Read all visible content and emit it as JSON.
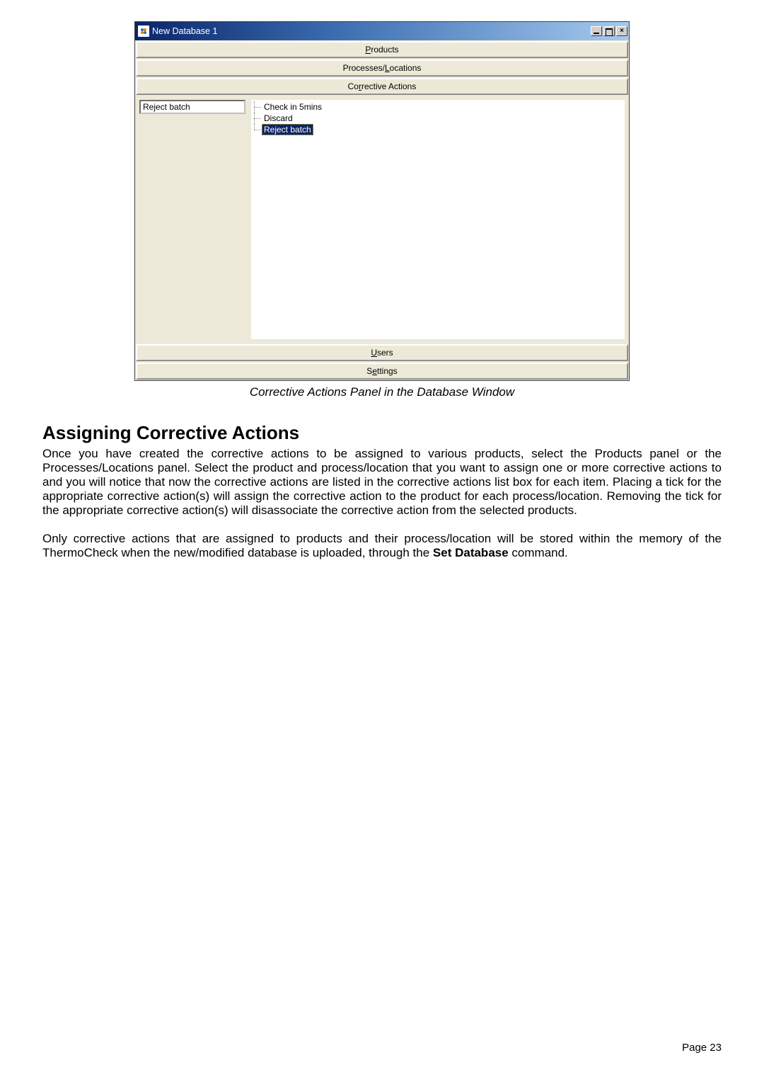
{
  "window": {
    "title": "New Database 1",
    "textbox_value": "Reject batch"
  },
  "accordion": {
    "products_prefix": "P",
    "products_rest": "roducts",
    "processes_pre": "Processes/",
    "processes_u": "L",
    "processes_post": "ocations",
    "corrective_pre": "Co",
    "corrective_u": "r",
    "corrective_post": "rective Actions",
    "users_u": "U",
    "users_post": "sers",
    "settings_pre": "S",
    "settings_u": "e",
    "settings_post": "ttings"
  },
  "tree": {
    "item1": "Check in 5mins",
    "item2": "Discard",
    "item3": "Reject batch"
  },
  "caption": "Corrective Actions Panel in the Database Window",
  "heading": "Assigning Corrective Actions",
  "para1": "Once you have created the corrective actions to be assigned to various products, select the Products panel or the Processes/Locations panel.  Select the product and process/location that you want to assign one or more corrective actions to and you will notice that now the corrective actions are listed in the corrective actions list box for each item.  Placing a tick for the appropriate corrective action(s) will assign the corrective action to the product for each process/location.  Removing the tick for the appropriate corrective action(s) will disassociate the corrective action from the selected products.",
  "para2_pre": "Only corrective actions that are assigned to products and their process/location will be stored within the memory of the ThermoCheck when the new/modified database is uploaded, through the ",
  "para2_bold": "Set Database",
  "para2_post": " command.",
  "page": "Page 23"
}
